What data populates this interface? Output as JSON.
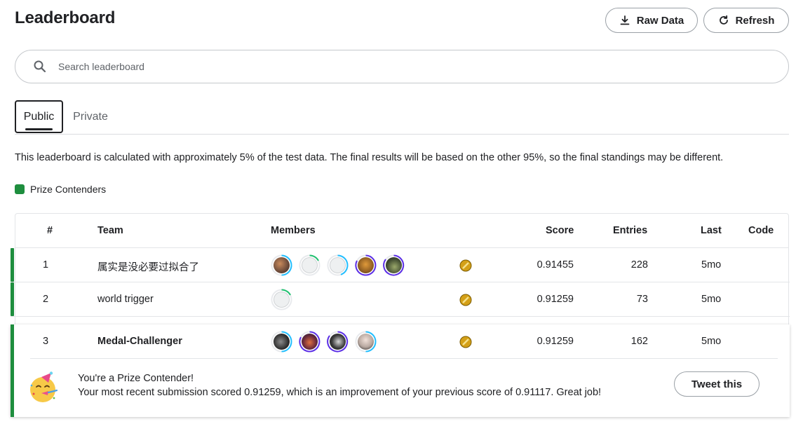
{
  "page": {
    "title": "Leaderboard"
  },
  "actions": {
    "raw_data_label": "Raw Data",
    "refresh_label": "Refresh"
  },
  "search": {
    "placeholder": "Search leaderboard",
    "value": ""
  },
  "tabs": [
    {
      "label": "Public",
      "active": true
    },
    {
      "label": "Private",
      "active": false
    }
  ],
  "notice": "This leaderboard is calculated with approximately 5% of the test data. The final results will be based on the other 95%, so the final standings may be different.",
  "legend": {
    "label": "Prize Contenders",
    "color": "#1e8e3e"
  },
  "table": {
    "columns": [
      "#",
      "Team",
      "Members",
      "Score",
      "Entries",
      "Last",
      "Code"
    ],
    "rows": [
      {
        "rank": "1",
        "team": "属实是没必要过拟合了",
        "score": "0.91455",
        "entries": "228",
        "last": "5mo",
        "medal": "gold",
        "members": 5
      },
      {
        "rank": "2",
        "team": "world trigger",
        "score": "0.91259",
        "entries": "73",
        "last": "5mo",
        "medal": "gold",
        "members": 1
      },
      {
        "rank": "3",
        "team": "Medal-Challenger",
        "score": "0.91259",
        "entries": "162",
        "last": "5mo",
        "medal": "gold",
        "members": 4
      }
    ]
  },
  "contender_message": {
    "title": "You're a Prize Contender!",
    "body": "Your most recent submission scored 0.91259, which is an improvement of your previous score of 0.91117. Great job!",
    "button_label": "Tweet this",
    "icon": "party-face-icon"
  }
}
